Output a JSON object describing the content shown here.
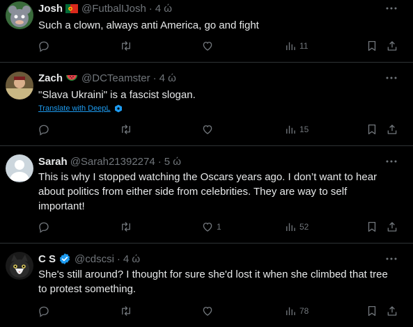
{
  "tweets": [
    {
      "name": "Josh",
      "handle": "@FutbalIJosh",
      "dot": "·",
      "time": "4 ώ",
      "flag_icon": "portugal-flag-icon",
      "text": "Such a clown, always anti America, go and fight",
      "replies": "",
      "likes": "",
      "views": "11"
    },
    {
      "name": "Zach",
      "handle": "@DCTeamster",
      "dot": "·",
      "time": "4 ώ",
      "flag_icon": "watermelon-icon",
      "text": "\"Slava Ukraini\" is a fascist slogan.",
      "translate": "Translate with DeepL",
      "replies": "",
      "likes": "",
      "views": "15"
    },
    {
      "name": "Sarah",
      "handle": "@Sarah21392274",
      "dot": "·",
      "time": "5 ώ",
      "text_lines": [
        "This is why I stopped watching the Oscars years ago. I don’t want to hear",
        "about politics from either side from celebrities. They are way to self",
        "important!"
      ],
      "replies": "",
      "likes": "1",
      "views": "52"
    },
    {
      "name": "C S",
      "handle": "@cdscsi",
      "dot": "·",
      "time": "4 ώ",
      "verified_icon": "verified-badge-icon",
      "text_lines": [
        "She's still around? I thought for sure she'd lost it when she climbed that tree",
        "to protest something."
      ],
      "replies": "",
      "likes": "",
      "views": "78"
    }
  ],
  "colors": {
    "background": "#000000",
    "text": "#e7e9ea",
    "muted": "#71767b",
    "link": "#1d9bf0",
    "divider": "#2f3336"
  }
}
